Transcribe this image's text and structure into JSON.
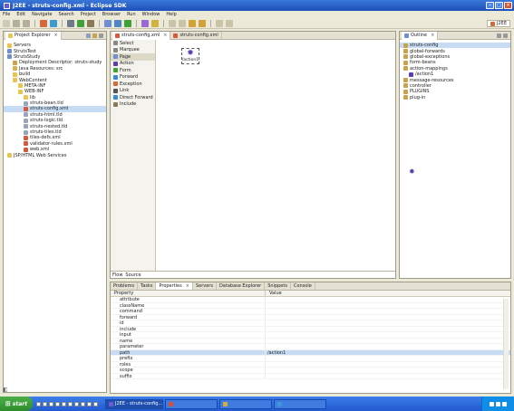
{
  "window": {
    "title": "J2EE - struts-config.xml - Eclipse SDK"
  },
  "menu": [
    "File",
    "Edit",
    "Navigate",
    "Search",
    "Project",
    "Browser",
    "Run",
    "Window",
    "Help"
  ],
  "perspective": {
    "label": "J2EE"
  },
  "project_explorer": {
    "tab_label": "Project Explorer",
    "rows": [
      {
        "indent": 1,
        "label": "Servers",
        "icon": "folder-icon",
        "color": "#e8c450"
      },
      {
        "indent": 1,
        "label": "StrutsTest",
        "icon": "project-icon",
        "color": "#6d8fd2"
      },
      {
        "indent": 1,
        "label": "StrutsStudy",
        "icon": "project-icon",
        "color": "#6d8fd2"
      },
      {
        "indent": 2,
        "label": "Deployment Descriptor: struts-study",
        "icon": "descriptor-icon",
        "color": "#c9a24c"
      },
      {
        "indent": 2,
        "label": "Java Resources: src",
        "icon": "source-folder-icon",
        "color": "#d7b34e"
      },
      {
        "indent": 2,
        "label": "build",
        "icon": "folder-icon",
        "color": "#e8c450"
      },
      {
        "indent": 2,
        "label": "WebContent",
        "icon": "folder-icon",
        "color": "#e8c450"
      },
      {
        "indent": 3,
        "label": "META-INF",
        "icon": "folder-icon",
        "color": "#e8c450"
      },
      {
        "indent": 3,
        "label": "WEB-INF",
        "icon": "folder-icon",
        "color": "#e8c450"
      },
      {
        "indent": 4,
        "label": "lib",
        "icon": "folder-icon",
        "color": "#e8c450"
      },
      {
        "indent": 4,
        "label": "struts-bean.tld",
        "icon": "file-icon",
        "color": "#9aa6b8"
      },
      {
        "indent": 4,
        "label": "struts-config.xml",
        "icon": "xml-file-icon",
        "color": "#d35a3a",
        "selected": true
      },
      {
        "indent": 4,
        "label": "struts-html.tld",
        "icon": "file-icon",
        "color": "#9aa6b8"
      },
      {
        "indent": 4,
        "label": "struts-logic.tld",
        "icon": "file-icon",
        "color": "#9aa6b8"
      },
      {
        "indent": 4,
        "label": "struts-nested.tld",
        "icon": "file-icon",
        "color": "#9aa6b8"
      },
      {
        "indent": 4,
        "label": "struts-tiles.tld",
        "icon": "file-icon",
        "color": "#9aa6b8"
      },
      {
        "indent": 4,
        "label": "tiles-defs.xml",
        "icon": "xml-file-icon",
        "color": "#d35a3a"
      },
      {
        "indent": 4,
        "label": "validator-rules.xml",
        "icon": "xml-file-icon",
        "color": "#d35a3a"
      },
      {
        "indent": 4,
        "label": "web.xml",
        "icon": "xml-file-icon",
        "color": "#d35a3a"
      },
      {
        "indent": 1,
        "label": "JSP/HTML Web Services",
        "icon": "folder-icon",
        "color": "#e8c450"
      }
    ]
  },
  "editor": {
    "tabs": [
      {
        "label": "struts-config.xml",
        "active": true
      },
      {
        "label": "struts-config.xml",
        "active": false
      }
    ],
    "palette": [
      "Select",
      "Marquee",
      "Page",
      "Action",
      "Form",
      "Forward",
      "Exception",
      "Link",
      "Direct Forward",
      "Include"
    ],
    "node_label": "/action1",
    "bottom_tabs": [
      "Flow",
      "Source"
    ]
  },
  "outline": {
    "tab_label": "Outline",
    "rows": [
      {
        "indent": 1,
        "label": "struts-config",
        "selected": true
      },
      {
        "indent": 1,
        "label": "global-forwards"
      },
      {
        "indent": 1,
        "label": "global-exceptions"
      },
      {
        "indent": 1,
        "label": "form-beans"
      },
      {
        "indent": 1,
        "label": "action-mappings"
      },
      {
        "indent": 2,
        "label": "/action1"
      },
      {
        "indent": 1,
        "label": "message-resources"
      },
      {
        "indent": 1,
        "label": "controller"
      },
      {
        "indent": 1,
        "label": "PLUGINS"
      },
      {
        "indent": 1,
        "label": "plug-in"
      }
    ]
  },
  "bottom_panel": {
    "tabs": [
      "Problems",
      "Tasks",
      "Properties",
      "Servers",
      "Database Explorer",
      "Snippets",
      "Console"
    ],
    "active_tab": "Properties",
    "columns": [
      "Property",
      "Value"
    ],
    "rows": [
      {
        "k": "attribute",
        "v": ""
      },
      {
        "k": "className",
        "v": ""
      },
      {
        "k": "command",
        "v": ""
      },
      {
        "k": "forward",
        "v": ""
      },
      {
        "k": "id",
        "v": ""
      },
      {
        "k": "include",
        "v": ""
      },
      {
        "k": "input",
        "v": ""
      },
      {
        "k": "name",
        "v": ""
      },
      {
        "k": "parameter",
        "v": ""
      },
      {
        "k": "path",
        "v": "/action1",
        "selected": true
      },
      {
        "k": "prefix",
        "v": ""
      },
      {
        "k": "roles",
        "v": ""
      },
      {
        "k": "scope",
        "v": ""
      },
      {
        "k": "suffix",
        "v": ""
      }
    ]
  },
  "taskbar": {
    "start_label": "start",
    "tasks": [
      {
        "label": "J2EE - struts-config...",
        "active": true
      },
      {
        "label": ""
      },
      {
        "label": ""
      },
      {
        "label": ""
      }
    ]
  }
}
